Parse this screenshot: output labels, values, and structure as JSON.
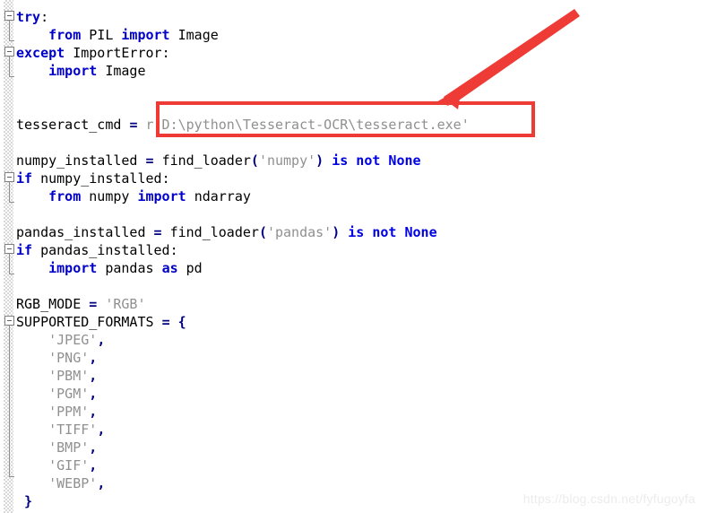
{
  "editor": {
    "language": "python",
    "background_color": "#ffffff",
    "gutter_color": "#d8d8d8",
    "colors": {
      "keyword": "#0000c8",
      "builtin": "#0000e6",
      "operator": "#000080",
      "string": "#909090",
      "identifier": "#000000",
      "annotation_red": "#ef3b36",
      "watermark": "#ececed"
    },
    "lines": [
      {
        "n": 1,
        "indent": 0,
        "text": "try:",
        "fold": "start"
      },
      {
        "n": 2,
        "indent": 1,
        "text": "from PIL import Image",
        "fold": "end"
      },
      {
        "n": 3,
        "indent": 0,
        "text": "except ImportError:",
        "fold": "start"
      },
      {
        "n": 4,
        "indent": 1,
        "text": "import Image",
        "fold": "end"
      },
      {
        "n": 5,
        "indent": 0,
        "text": "",
        "fold": "none"
      },
      {
        "n": 6,
        "indent": 0,
        "text": "",
        "fold": "none"
      },
      {
        "n": 7,
        "indent": 0,
        "text": "tesseract_cmd = r'D:\\python\\Tesseract-OCR\\tesseract.exe'",
        "fold": "none"
      },
      {
        "n": 8,
        "indent": 0,
        "text": "",
        "fold": "none"
      },
      {
        "n": 9,
        "indent": 0,
        "text": "numpy_installed = find_loader('numpy') is not None",
        "fold": "none"
      },
      {
        "n": 10,
        "indent": 0,
        "text": "if numpy_installed:",
        "fold": "start"
      },
      {
        "n": 11,
        "indent": 1,
        "text": "from numpy import ndarray",
        "fold": "end"
      },
      {
        "n": 12,
        "indent": 0,
        "text": "",
        "fold": "none"
      },
      {
        "n": 13,
        "indent": 0,
        "text": "pandas_installed = find_loader('pandas') is not None",
        "fold": "none"
      },
      {
        "n": 14,
        "indent": 0,
        "text": "if pandas_installed:",
        "fold": "start"
      },
      {
        "n": 15,
        "indent": 1,
        "text": "import pandas as pd",
        "fold": "end"
      },
      {
        "n": 16,
        "indent": 0,
        "text": "",
        "fold": "none"
      },
      {
        "n": 17,
        "indent": 0,
        "text": "RGB_MODE = 'RGB'",
        "fold": "none"
      },
      {
        "n": 18,
        "indent": 0,
        "text": "SUPPORTED_FORMATS = {",
        "fold": "start"
      },
      {
        "n": 19,
        "indent": 1,
        "text": "'JPEG',",
        "fold": "none"
      },
      {
        "n": 20,
        "indent": 1,
        "text": "'PNG',",
        "fold": "none"
      },
      {
        "n": 21,
        "indent": 1,
        "text": "'PBM',",
        "fold": "none"
      },
      {
        "n": 22,
        "indent": 1,
        "text": "'PGM',",
        "fold": "none"
      },
      {
        "n": 23,
        "indent": 1,
        "text": "'PPM',",
        "fold": "none"
      },
      {
        "n": 24,
        "indent": 1,
        "text": "'TIFF',",
        "fold": "none"
      },
      {
        "n": 25,
        "indent": 1,
        "text": "'BMP',",
        "fold": "none"
      },
      {
        "n": 26,
        "indent": 1,
        "text": "'GIF',",
        "fold": "none"
      },
      {
        "n": 27,
        "indent": 1,
        "text": "'WEBP',",
        "fold": "end"
      },
      {
        "n": 28,
        "indent": 0,
        "text": "}",
        "fold": "none"
      }
    ],
    "supported_formats": [
      "JPEG",
      "PNG",
      "PBM",
      "PGM",
      "PPM",
      "TIFF",
      "BMP",
      "GIF",
      "WEBP"
    ],
    "rgb_mode_value": "RGB",
    "tesseract_cmd_value": "r'D:\\python\\Tesseract-OCR\\tesseract.exe'"
  },
  "annotations": {
    "highlight_box": {
      "label": "tesseract-cmd-path-highlight",
      "target_text": "r'D:\\python\\Tesseract-OCR\\tesseract.exe'",
      "color": "#ef3b36"
    },
    "arrow": {
      "label": "pointer-arrow",
      "direction": "down-left",
      "color": "#ef3b36"
    }
  },
  "watermark": {
    "text": "https://blog.csdn.net/fyfugoyfa"
  }
}
